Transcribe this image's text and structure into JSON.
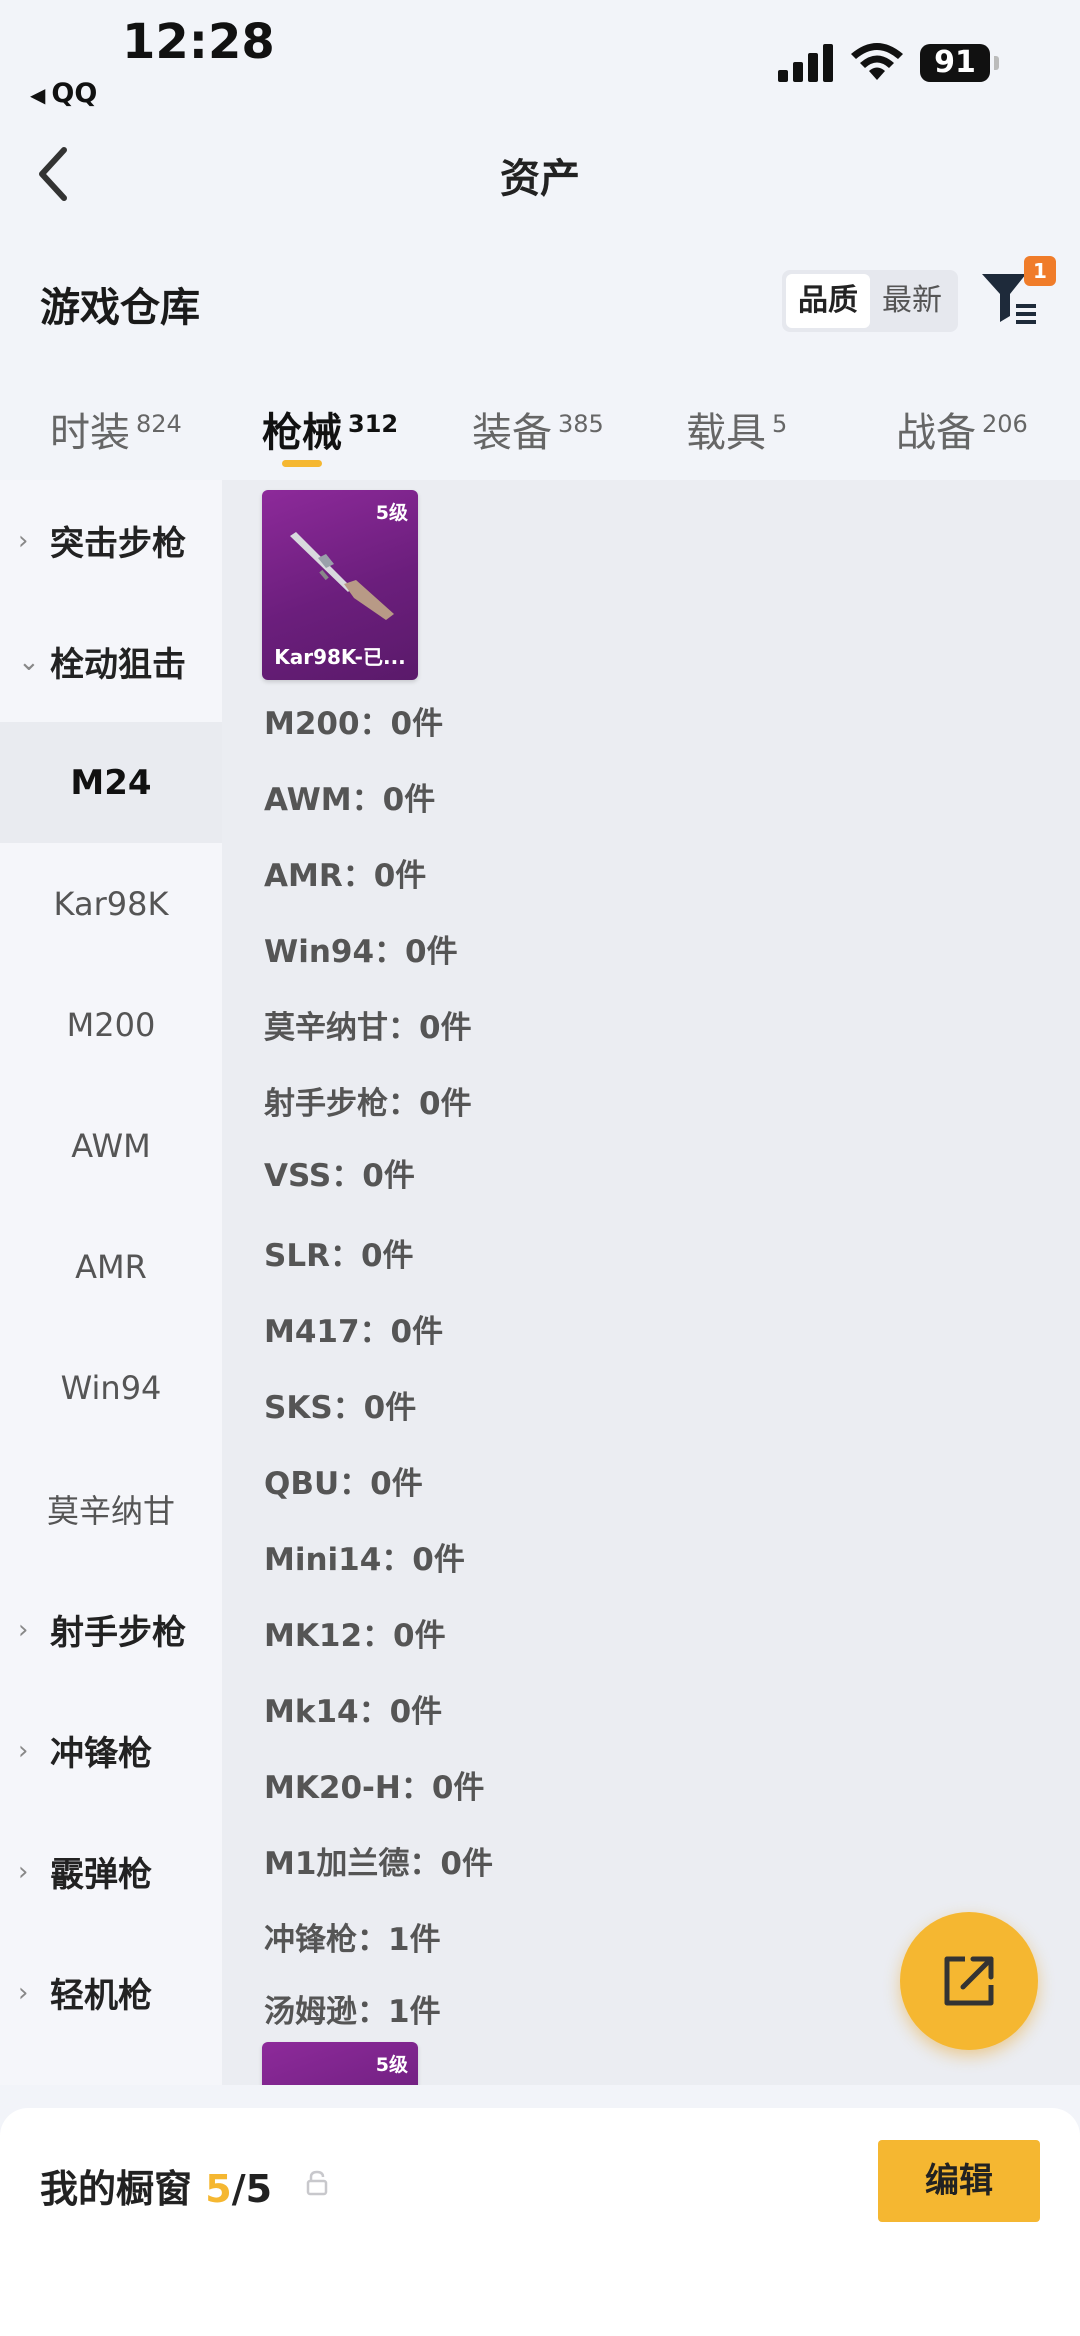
{
  "status_bar": {
    "time": "12:28",
    "back_app": "QQ",
    "battery": "91"
  },
  "nav": {
    "title": "资产"
  },
  "section": {
    "title": "游戏仓库",
    "sort_options": [
      "品质",
      "最新"
    ],
    "filter_badge": "1"
  },
  "tabs": [
    {
      "label": "时装",
      "count": "824"
    },
    {
      "label": "枪械",
      "count": "312"
    },
    {
      "label": "装备",
      "count": "385"
    },
    {
      "label": "载具",
      "count": "5"
    },
    {
      "label": "战备",
      "count": "206"
    }
  ],
  "sidebar": {
    "items": [
      {
        "label": "突击步枪",
        "type": "category",
        "chevron": "›"
      },
      {
        "label": "栓动狙击",
        "type": "category",
        "chevron": "⌄"
      },
      {
        "label": "M24",
        "type": "selected"
      },
      {
        "label": "Kar98K",
        "type": "sub"
      },
      {
        "label": "M200",
        "type": "sub"
      },
      {
        "label": "AWM",
        "type": "sub"
      },
      {
        "label": "AMR",
        "type": "sub"
      },
      {
        "label": "Win94",
        "type": "sub"
      },
      {
        "label": "莫辛纳甘",
        "type": "sub"
      },
      {
        "label": "射手步枪",
        "type": "category",
        "chevron": "›"
      },
      {
        "label": "冲锋枪",
        "type": "category",
        "chevron": "›"
      },
      {
        "label": "霰弹枪",
        "type": "category",
        "chevron": "›"
      },
      {
        "label": "轻机枪",
        "type": "category",
        "chevron": "›"
      }
    ]
  },
  "main": {
    "top_card": {
      "level": "5级",
      "name": "Kar98K-已..."
    },
    "rows": [
      "M200：0件",
      "AWM：0件",
      "AMR：0件",
      "Win94：0件",
      "莫辛纳甘：0件",
      "射手步枪：0件",
      "VSS：0件",
      "SLR：0件",
      "M417：0件",
      "SKS：0件",
      "QBU：0件",
      "Mini14：0件",
      "MK12：0件",
      "Mk14：0件",
      "MK20-H：0件",
      "M1加兰德：0件",
      "冲锋枪：1件",
      "汤姆逊：1件"
    ],
    "bottom_card": {
      "level": "5级"
    }
  },
  "bottom_bar": {
    "label": "我的橱窗",
    "count": "5",
    "total": "/5",
    "edit_label": "编辑"
  }
}
